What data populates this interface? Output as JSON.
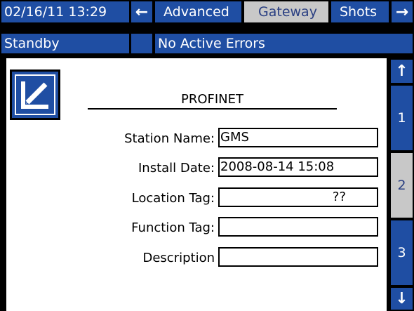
{
  "header": {
    "datetime": "02/16/11 13:29",
    "back_arrow": "←",
    "forward_arrow": "→",
    "tabs": [
      {
        "label": "Advanced",
        "active": false
      },
      {
        "label": "Gateway",
        "active": true
      },
      {
        "label": "Shots",
        "active": false
      }
    ]
  },
  "status": {
    "mode": "Standby",
    "errors": "No Active Errors"
  },
  "edit_icon": "edit-pencil-icon",
  "form": {
    "title": "PROFINET",
    "fields": [
      {
        "label": "Station Name:",
        "value": "GMS"
      },
      {
        "label": "Install Date:",
        "value": "2008-08-14 15:08"
      },
      {
        "label": "Location Tag:",
        "value": "??"
      },
      {
        "label": "Function Tag:",
        "value": ""
      },
      {
        "label": "Description",
        "value": ""
      }
    ]
  },
  "pager": {
    "up_arrow": "↑",
    "down_arrow": "↓",
    "pages": [
      {
        "label": "1",
        "active": false
      },
      {
        "label": "2",
        "active": true
      },
      {
        "label": "3",
        "active": false
      }
    ]
  },
  "colors": {
    "primary_blue": "#1f4ea3",
    "selected_gray": "#c8c8c8",
    "background": "#ffffff"
  }
}
